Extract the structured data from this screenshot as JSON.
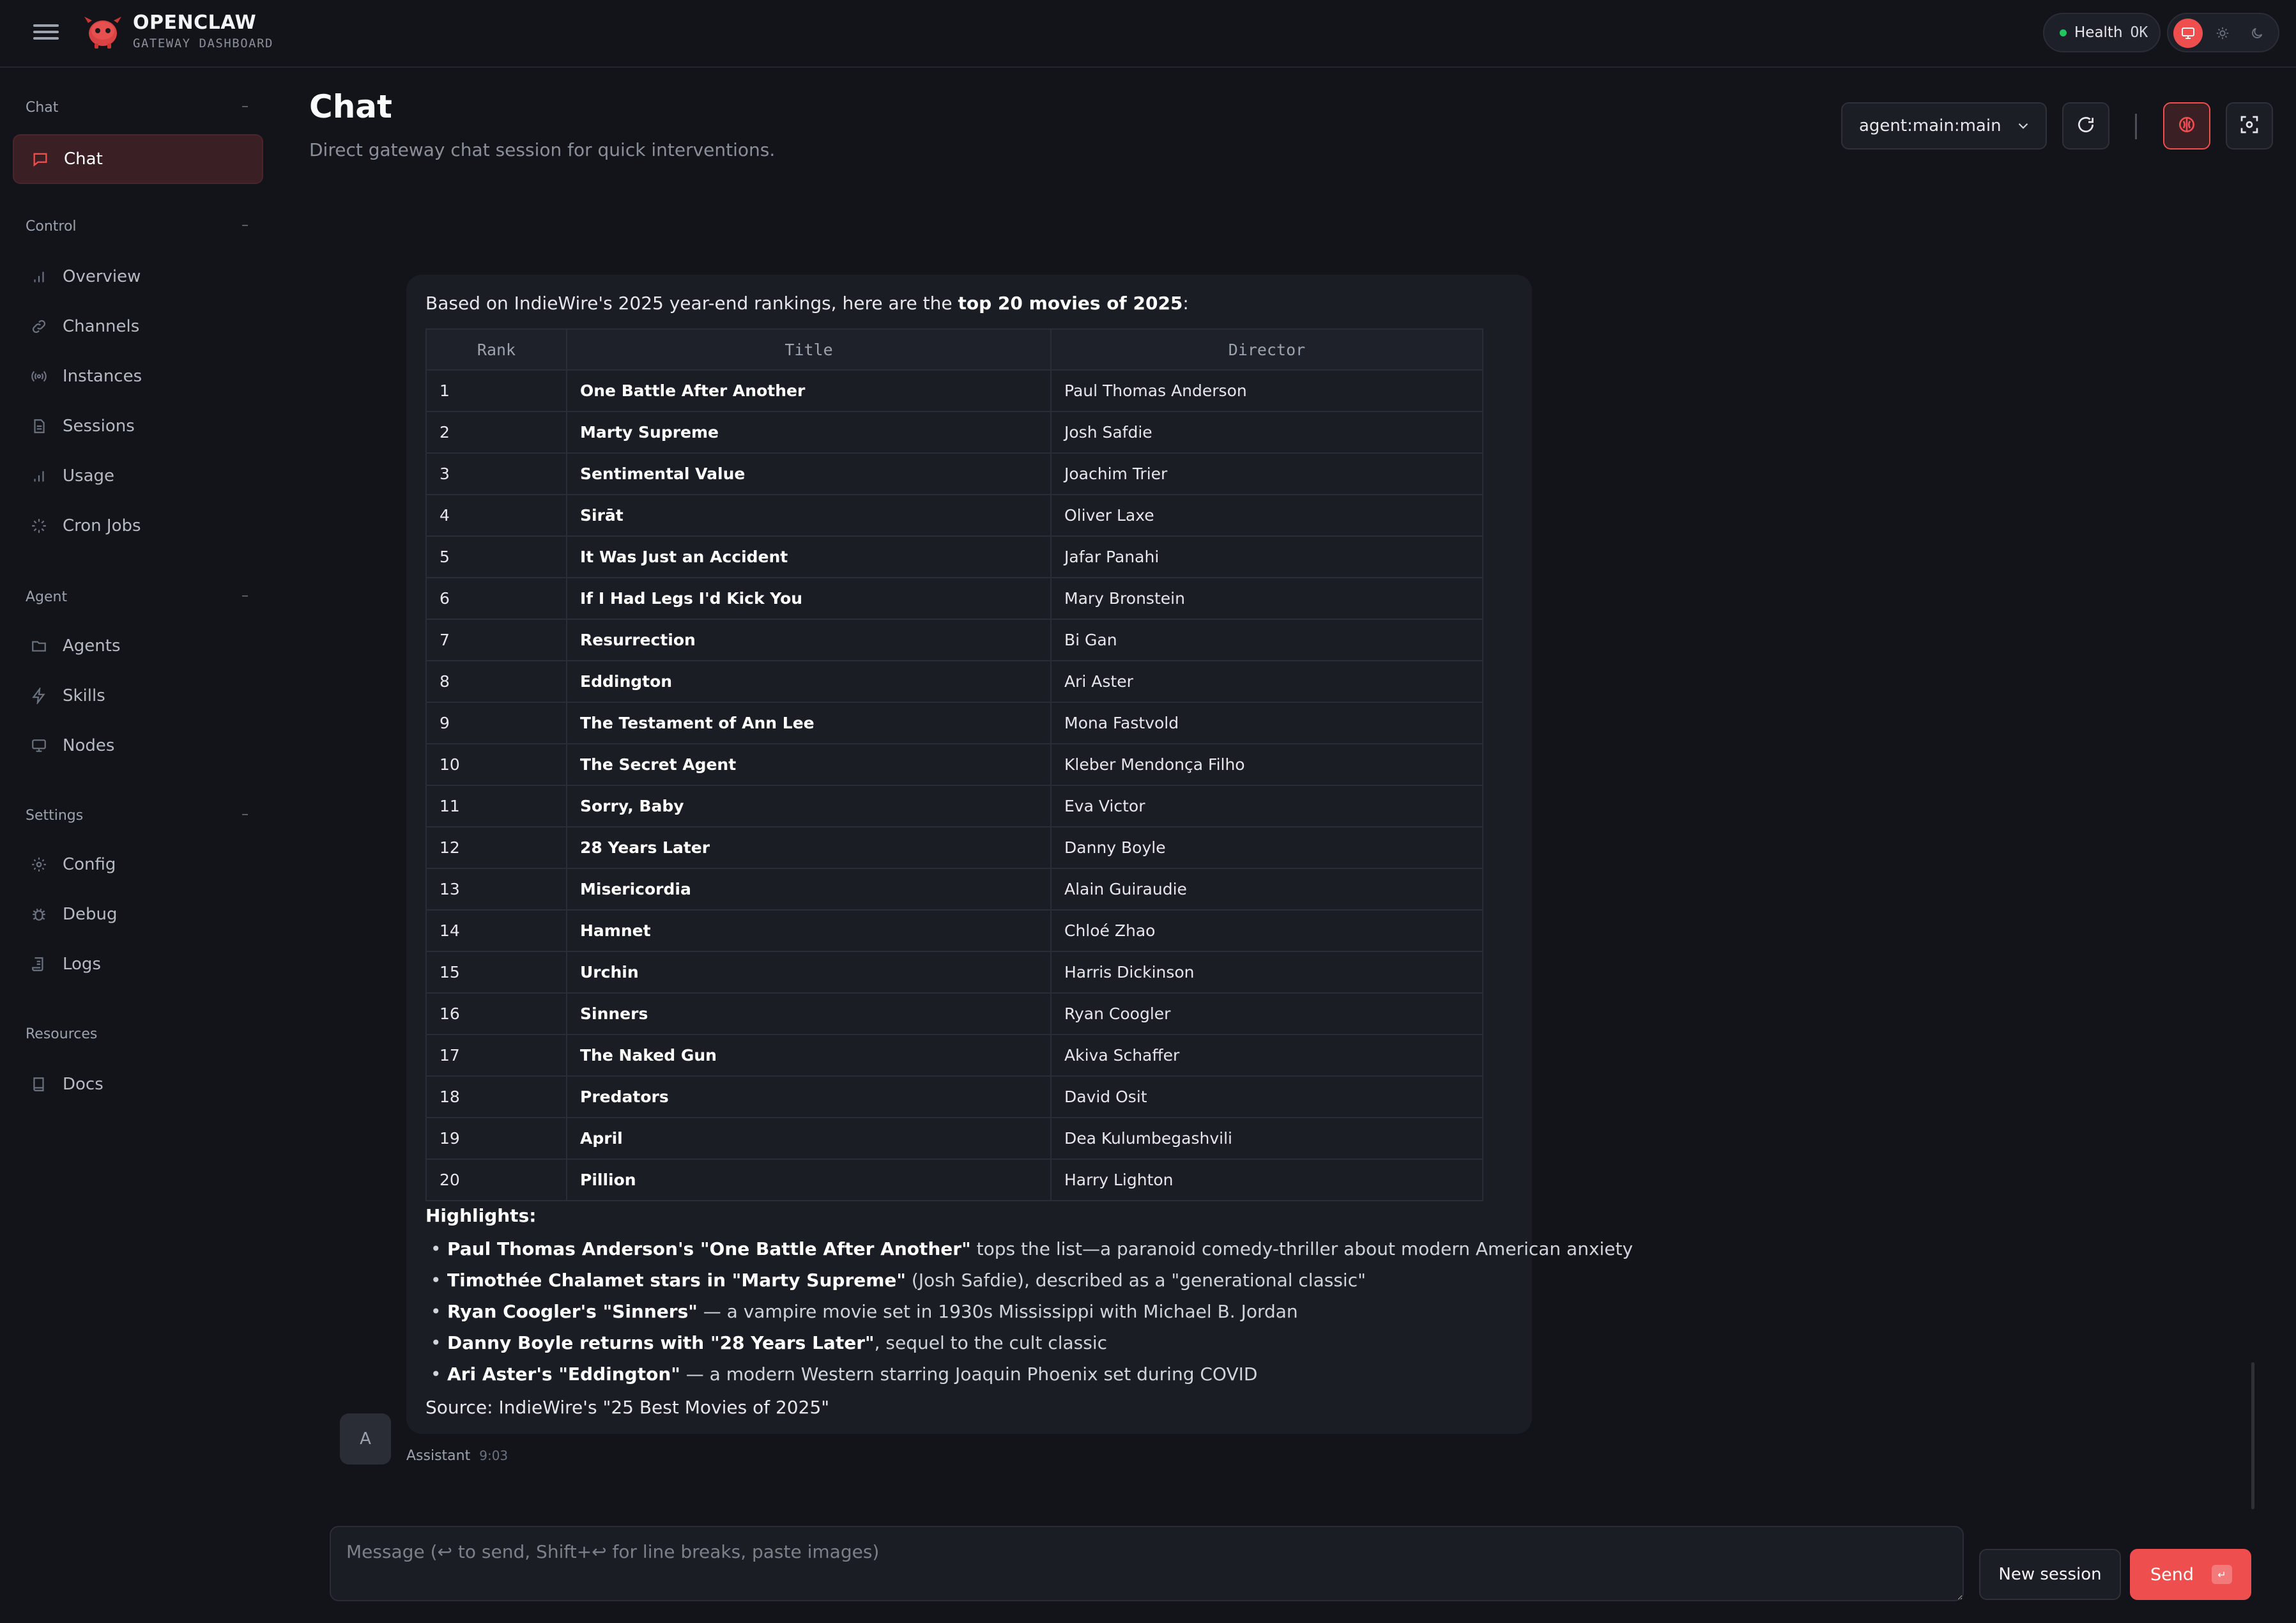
{
  "brand": {
    "title": "OPENCLAW",
    "subtitle": "GATEWAY DASHBOARD"
  },
  "health": {
    "label": "Health",
    "status": "OK",
    "color": "#22c55e"
  },
  "theme": {
    "options": [
      "monitor-icon",
      "sun-icon",
      "moon-icon"
    ],
    "active": "monitor-icon",
    "accent": "#ef4e4e"
  },
  "sidebar": {
    "sections": [
      {
        "title": "Chat",
        "items": [
          {
            "label": "Chat",
            "icon": "chat-icon",
            "active": true
          }
        ]
      },
      {
        "title": "Control",
        "items": [
          {
            "label": "Overview",
            "icon": "bar-chart-icon"
          },
          {
            "label": "Channels",
            "icon": "link-icon"
          },
          {
            "label": "Instances",
            "icon": "broadcast-icon"
          },
          {
            "label": "Sessions",
            "icon": "document-icon"
          },
          {
            "label": "Usage",
            "icon": "bar-chart-icon"
          },
          {
            "label": "Cron Jobs",
            "icon": "loader-icon"
          }
        ]
      },
      {
        "title": "Agent",
        "items": [
          {
            "label": "Agents",
            "icon": "folder-icon"
          },
          {
            "label": "Skills",
            "icon": "bolt-icon"
          },
          {
            "label": "Nodes",
            "icon": "monitor-icon"
          }
        ]
      },
      {
        "title": "Settings",
        "items": [
          {
            "label": "Config",
            "icon": "gear-icon"
          },
          {
            "label": "Debug",
            "icon": "bug-icon"
          },
          {
            "label": "Logs",
            "icon": "scroll-icon"
          }
        ]
      },
      {
        "title": "Resources",
        "items": [
          {
            "label": "Docs",
            "icon": "book-icon"
          }
        ]
      }
    ]
  },
  "header": {
    "title": "Chat",
    "subtitle": "Direct gateway chat session for quick interventions.",
    "session": "agent:main:main"
  },
  "message": {
    "intro_prefix": "Based on IndieWire's 2025 year-end rankings, here are the ",
    "intro_bold": "top 20 movies of 2025",
    "intro_suffix": ":",
    "table": {
      "headers": [
        "Rank",
        "Title",
        "Director"
      ],
      "rows": [
        [
          "1",
          "One Battle After Another",
          "Paul Thomas Anderson"
        ],
        [
          "2",
          "Marty Supreme",
          "Josh Safdie"
        ],
        [
          "3",
          "Sentimental Value",
          "Joachim Trier"
        ],
        [
          "4",
          "Sirāt",
          "Oliver Laxe"
        ],
        [
          "5",
          "It Was Just an Accident",
          "Jafar Panahi"
        ],
        [
          "6",
          "If I Had Legs I'd Kick You",
          "Mary Bronstein"
        ],
        [
          "7",
          "Resurrection",
          "Bi Gan"
        ],
        [
          "8",
          "Eddington",
          "Ari Aster"
        ],
        [
          "9",
          "The Testament of Ann Lee",
          "Mona Fastvold"
        ],
        [
          "10",
          "The Secret Agent",
          "Kleber Mendonça Filho"
        ],
        [
          "11",
          "Sorry, Baby",
          "Eva Victor"
        ],
        [
          "12",
          "28 Years Later",
          "Danny Boyle"
        ],
        [
          "13",
          "Misericordia",
          "Alain Guiraudie"
        ],
        [
          "14",
          "Hamnet",
          "Chloé Zhao"
        ],
        [
          "15",
          "Urchin",
          "Harris Dickinson"
        ],
        [
          "16",
          "Sinners",
          "Ryan Coogler"
        ],
        [
          "17",
          "The Naked Gun",
          "Akiva Schaffer"
        ],
        [
          "18",
          "Predators",
          "David Osit"
        ],
        [
          "19",
          "April",
          "Dea Kulumbegashvili"
        ],
        [
          "20",
          "Pillion",
          "Harry Lighton"
        ]
      ]
    },
    "highlights_title": "Highlights:",
    "highlights": [
      {
        "bold": "Paul Thomas Anderson's \"One Battle After Another\"",
        "text": " tops the list—a paranoid comedy-thriller about modern American anxiety"
      },
      {
        "bold": "Timothée Chalamet stars in \"Marty Supreme\"",
        "text": " (Josh Safdie), described as a \"generational classic\""
      },
      {
        "bold": "Ryan Coogler's \"Sinners\"",
        "text": " — a vampire movie set in 1930s Mississippi with Michael B. Jordan"
      },
      {
        "bold": "Danny Boyle returns with \"28 Years Later\"",
        "text": ", sequel to the cult classic"
      },
      {
        "bold": "Ari Aster's \"Eddington\"",
        "text": " — a modern Western starring Joaquin Phoenix set during COVID"
      }
    ],
    "source": "Source: IndieWire's \"25 Best Movies of 2025\"",
    "avatar": "A",
    "sender": "Assistant",
    "time": "9:03"
  },
  "composer": {
    "placeholder": "Message (↩ to send, Shift+↩ for line breaks, paste images)",
    "new_session": "New session",
    "send": "Send",
    "send_key": "↵"
  }
}
